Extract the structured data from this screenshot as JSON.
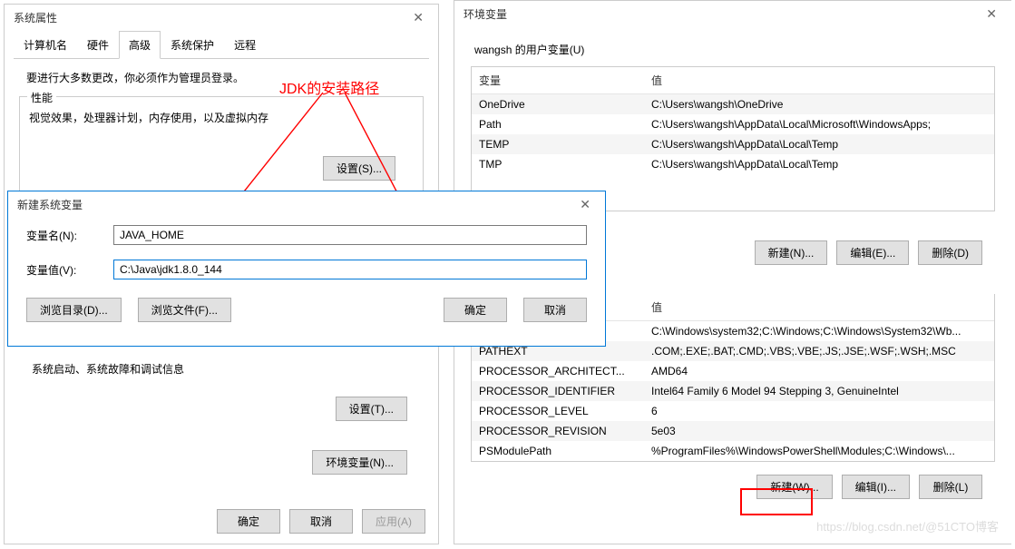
{
  "sysprops": {
    "title": "系统属性",
    "tabs": {
      "t0": "计算机名",
      "t1": "硬件",
      "t2": "高级",
      "t3": "系统保护",
      "t4": "远程"
    },
    "notice": "要进行大多数更改，你必须作为管理员登录。",
    "perf": {
      "title": "性能",
      "desc": "视觉效果，处理器计划，内存使用，以及虚拟内存",
      "btn": "设置(S)..."
    },
    "startup_text": "系统启动、系统故障和调试信息",
    "settings_t": "设置(T)...",
    "envvars_btn": "环境变量(N)...",
    "ok": "确定",
    "cancel": "取消",
    "apply": "应用(A)"
  },
  "newvar": {
    "title": "新建系统变量",
    "name_label": "变量名(N):",
    "value_label": "变量值(V):",
    "name_value": "JAVA_HOME",
    "value_value": "C:\\Java\\jdk1.8.0_144",
    "browse_dir": "浏览目录(D)...",
    "browse_file": "浏览文件(F)...",
    "ok": "确定",
    "cancel": "取消"
  },
  "envdlg": {
    "title": "环境变量",
    "user_section": "wangsh 的用户变量(U)",
    "col_var": "变量",
    "col_val": "值",
    "user_vars": [
      {
        "name": "OneDrive",
        "value": "C:\\Users\\wangsh\\OneDrive"
      },
      {
        "name": "Path",
        "value": "C:\\Users\\wangsh\\AppData\\Local\\Microsoft\\WindowsApps;"
      },
      {
        "name": "TEMP",
        "value": "C:\\Users\\wangsh\\AppData\\Local\\Temp"
      },
      {
        "name": "TMP",
        "value": "C:\\Users\\wangsh\\AppData\\Local\\Temp"
      }
    ],
    "sys_vars": [
      {
        "name": "",
        "value": "C:\\Windows\\system32;C:\\Windows;C:\\Windows\\System32\\Wb..."
      },
      {
        "name": "PATHEXT",
        "value": ".COM;.EXE;.BAT;.CMD;.VBS;.VBE;.JS;.JSE;.WSF;.WSH;.MSC"
      },
      {
        "name": "PROCESSOR_ARCHITECT...",
        "value": "AMD64"
      },
      {
        "name": "PROCESSOR_IDENTIFIER",
        "value": "Intel64 Family 6 Model 94 Stepping 3, GenuineIntel"
      },
      {
        "name": "PROCESSOR_LEVEL",
        "value": "6"
      },
      {
        "name": "PROCESSOR_REVISION",
        "value": "5e03"
      },
      {
        "name": "PSModulePath",
        "value": "%ProgramFiles%\\WindowsPowerShell\\Modules;C:\\Windows\\..."
      }
    ],
    "sys_col_val": "值",
    "new_n": "新建(N)...",
    "edit_e": "编辑(E)...",
    "del_d": "删除(D)",
    "new_w": "新建(W)...",
    "edit_i": "编辑(I)...",
    "del_l": "删除(L)"
  },
  "annotation": "JDK的安装路径",
  "watermark": "https://blog.csdn.net/@51CTO博客"
}
